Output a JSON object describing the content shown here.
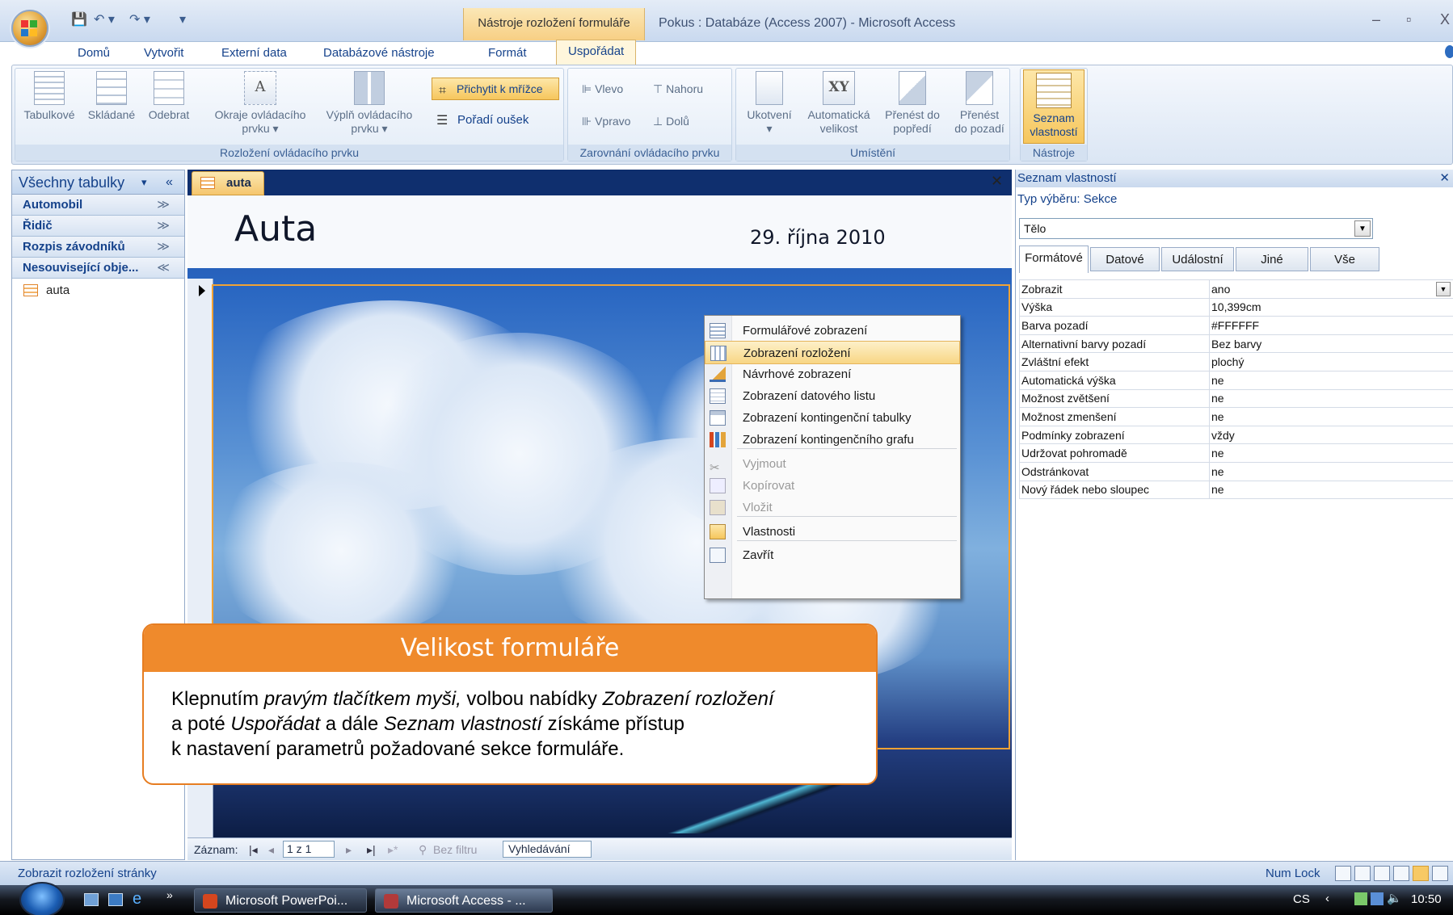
{
  "window": {
    "contextual_tab_group": "Nástroje rozložení formuláře",
    "title": "Pokus : Databáze (Access 2007) - Microsoft Access",
    "controls": [
      "–",
      "▫",
      "X"
    ]
  },
  "ribbon_tabs": [
    "Domů",
    "Vytvořit",
    "Externí data",
    "Databázové nástroje",
    "Formát",
    "Uspořádat"
  ],
  "active_tab": "Uspořádat",
  "ribbon": {
    "group1": {
      "caption": "Rozložení ovládacího prvku",
      "buttons": [
        "Tabulkové",
        "Skládané",
        "Odebrat"
      ],
      "okraje": [
        "Okraje ovládacího",
        "prvku ▾"
      ],
      "vyplne": [
        "Výplň ovládacího",
        "prvku ▾"
      ],
      "snap": "Přichytit k mřížce",
      "tab_order": "Pořadí oušek"
    },
    "group2": {
      "caption": "Zarovnání ovládacího prvku",
      "buttons": [
        "Vlevo",
        "Nahoru",
        "Vpravo",
        "Dolů"
      ]
    },
    "group3": {
      "caption": "Umístění",
      "buttons": [
        [
          "Ukotvení",
          "▾"
        ],
        [
          "Automatická",
          "velikost"
        ],
        [
          "Přenést do",
          "popředí"
        ],
        [
          "Přenést",
          "do pozadí"
        ]
      ]
    },
    "group4": {
      "caption": "Nástroje",
      "button": [
        "Seznam",
        "vlastností"
      ]
    }
  },
  "nav": {
    "header": "Všechny tabulky",
    "groups": [
      {
        "label": "Automobil",
        "chev": "≫"
      },
      {
        "label": "Řidič",
        "chev": "≫"
      },
      {
        "label": "Rozpis závodníků",
        "chev": "≫"
      },
      {
        "label": "Nesouvisející obje...",
        "chev": "≪"
      }
    ],
    "items": [
      "auta"
    ]
  },
  "document": {
    "tab": "auta",
    "form_title": "Auta",
    "form_date": "29. října 2010"
  },
  "context_menu": [
    {
      "label": "Formulářové zobrazení",
      "icon": "form-view-icon",
      "state": "normal"
    },
    {
      "label": "Zobrazení rozložení",
      "icon": "layout-view-icon",
      "state": "highlighted"
    },
    {
      "label": "Návrhové zobrazení",
      "icon": "design-view-icon",
      "state": "normal"
    },
    {
      "label": "Zobrazení datového listu",
      "icon": "datasheet-view-icon",
      "state": "normal"
    },
    {
      "label": "Zobrazení kontingenční tabulky",
      "icon": "pivot-table-icon",
      "state": "normal"
    },
    {
      "label": "Zobrazení kontingenčního grafu",
      "icon": "pivot-chart-icon",
      "state": "normal"
    },
    {
      "label": "Vyjmout",
      "icon": "cut-icon",
      "state": "disabled"
    },
    {
      "label": "Kopírovat",
      "icon": "copy-icon",
      "state": "disabled"
    },
    {
      "label": "Vložit",
      "icon": "paste-icon",
      "state": "disabled"
    },
    {
      "label": "Vlastnosti",
      "icon": "properties-icon",
      "state": "normal"
    },
    {
      "label": "Zavřít",
      "icon": "close-form-icon",
      "state": "normal"
    }
  ],
  "record_nav": {
    "label": "Záznam:",
    "position": "1 z 1",
    "filter": "Bez filtru",
    "search": "Vyhledávání"
  },
  "properties": {
    "header": "Seznam vlastností",
    "selection_type": "Typ výběru:  Sekce",
    "selected": "Tělo",
    "tabs": [
      "Formátové",
      "Datové",
      "Událostní",
      "Jiné",
      "Vše"
    ],
    "active_tab": "Formátové",
    "rows": [
      [
        "Zobrazit",
        "ano"
      ],
      [
        "Výška",
        "10,399cm"
      ],
      [
        "Barva pozadí",
        "#FFFFFF"
      ],
      [
        "Alternativní barvy pozadí",
        "Bez barvy"
      ],
      [
        "Zvláštní efekt",
        "plochý"
      ],
      [
        "Automatická výška",
        "ne"
      ],
      [
        "Možnost zvětšení",
        "ne"
      ],
      [
        "Možnost zmenšení",
        "ne"
      ],
      [
        "Podmínky zobrazení",
        "vždy"
      ],
      [
        "Udržovat pohromadě",
        "ne"
      ],
      [
        "Odstránkovat",
        "ne"
      ],
      [
        "Nový řádek nebo sloupec",
        "ne"
      ]
    ]
  },
  "callout": {
    "title": "Velikost  formuláře",
    "line1_a": "Klepnutím ",
    "line1_b": "pravým tlačítkem myši,",
    "line1_c": " volbou nabídky ",
    "line1_d": "Zobrazení rozložení",
    "line2_a": "a poté ",
    "line2_b": "Uspořádat",
    "line2_c": "  a dále ",
    "line2_d": "Seznam vlastností",
    "line2_e": " získáme přístup",
    "line3": "k nastavení parametrů požadované sekce formuláře."
  },
  "status": {
    "left": "Zobrazit rozložení stránky",
    "numlock": "Num Lock"
  },
  "taskbar": {
    "items": [
      "Microsoft PowerPoi...",
      "Microsoft Access - ..."
    ],
    "lang": "CS",
    "time": "10:50"
  },
  "colors": {
    "accent_orange": "#EF8A2C",
    "ribbon_blue": "#15428B",
    "highlight": "#F8D684"
  }
}
